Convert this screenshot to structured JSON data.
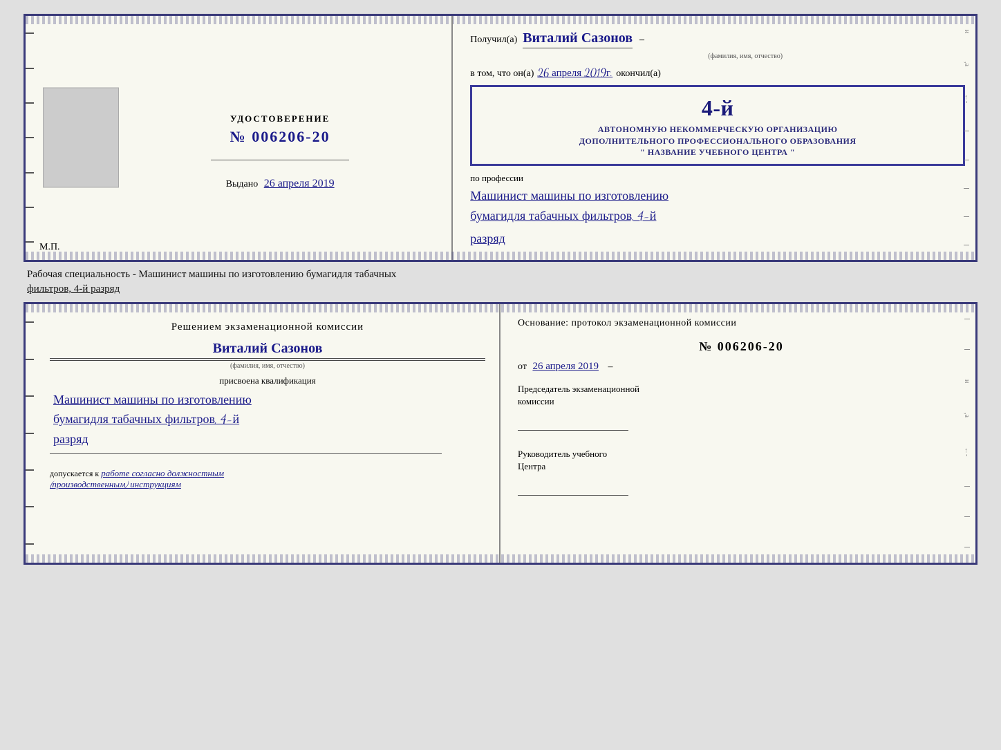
{
  "top_doc": {
    "left": {
      "udostoverenie_label": "УДОСТОВЕРЕНИЕ",
      "number_prefix": "№",
      "number": "006206-20",
      "vydano_label": "Выдано",
      "vydano_date": "26 апреля 2019",
      "mp_label": "М.П."
    },
    "right": {
      "poluchil_label": "Получил(а)",
      "recipient_name": "Виталий Сазонов",
      "fio_note": "(фамилия, имя, отчество)",
      "vtom_label": "в том, что он(а)",
      "date_value": "26 апреля 2019г.",
      "okonchil_label": "окончил(а)",
      "stamp_line1": "АВТОНОМНУЮ НЕКОММЕРЧЕСКУЮ ОРГАНИЗАЦИЮ",
      "stamp_line2": "ДОПОЛНИТЕЛЬНОГО ПРОФЕССИОНАЛЬНОГО ОБРАЗОВАНИЯ",
      "stamp_line3": "\" НАЗВАНИЕ УЧЕБНОГО ЦЕНТРА \"",
      "stamp_number": "4-й",
      "po_professii_label": "по профессии",
      "profession_line1": "Машинист машины по изготовлению",
      "profession_line2": "бумагидля табачных фильтров, 4-й",
      "profession_line3": "разряд"
    }
  },
  "separator": {
    "text1": "Рабочая специальность - Машинист машины по изготовлению бумагидля табачных",
    "text2": "фильтров, 4-й разряд"
  },
  "bottom_doc": {
    "left": {
      "resheniem_label": "Решением экзаменационной комиссии",
      "recipient_name": "Виталий Сазонов",
      "fio_note": "(фамилия, имя, отчество)",
      "prisvоena_label": "присвоена квалификация",
      "qualification_line1": "Машинист машины по изготовлению",
      "qualification_line2": "бумагидля табачных фильтров, 4-й",
      "qualification_line3": "разряд",
      "dopuskaetsya_label": "допускается к",
      "dopuskaetsya_value": "работе согласно должностным",
      "dopuskaetsya_value2": "(производственным) инструкциям"
    },
    "right": {
      "osnovanie_label": "Основание: протокол экзаменационной комиссии",
      "number_prefix": "№",
      "protocol_number": "006206-20",
      "ot_label": "от",
      "protocol_date": "26 апреля 2019",
      "predsedatel_label": "Председатель экзаменационной",
      "predsedatel_label2": "комиссии",
      "rukovoditel_label": "Руководитель учебного",
      "rukovoditel_label2": "Центра"
    }
  },
  "colors": {
    "border": "#3a3a7a",
    "handwritten": "#1a1a8a",
    "stamp_border": "#3a3a9a"
  }
}
